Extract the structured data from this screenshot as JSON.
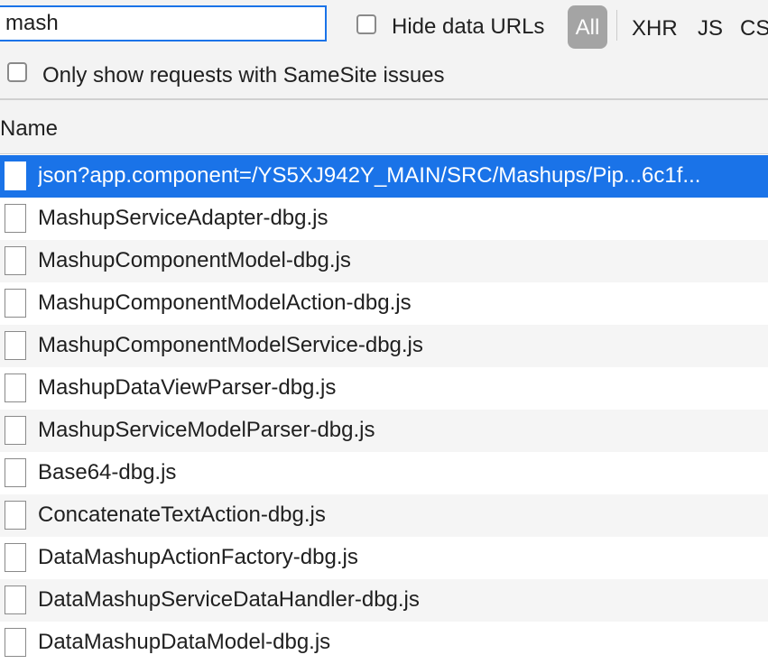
{
  "filter": {
    "value": "mash",
    "hide_data_urls_label": "Hide data URLs",
    "types": [
      "All",
      "XHR",
      "JS",
      "CS"
    ],
    "active_type": "All",
    "samesite_label": "Only show requests with SameSite issues"
  },
  "table": {
    "column_name": "Name",
    "rows": [
      "json?app.component=/YS5XJ942Y_MAIN/SRC/Mashups/Pip...6c1f...",
      "MashupServiceAdapter-dbg.js",
      "MashupComponentModel-dbg.js",
      "MashupComponentModelAction-dbg.js",
      "MashupComponentModelService-dbg.js",
      "MashupDataViewParser-dbg.js",
      "MashupServiceModelParser-dbg.js",
      "Base64-dbg.js",
      "ConcatenateTextAction-dbg.js",
      "DataMashupActionFactory-dbg.js",
      "DataMashupServiceDataHandler-dbg.js",
      "DataMashupDataModel-dbg.js"
    ],
    "selected_index": 0
  },
  "colors": {
    "accent": "#1a73e8",
    "toolbar_bg": "#f3f3f3",
    "active_filter_bg": "#a4a4a4"
  }
}
